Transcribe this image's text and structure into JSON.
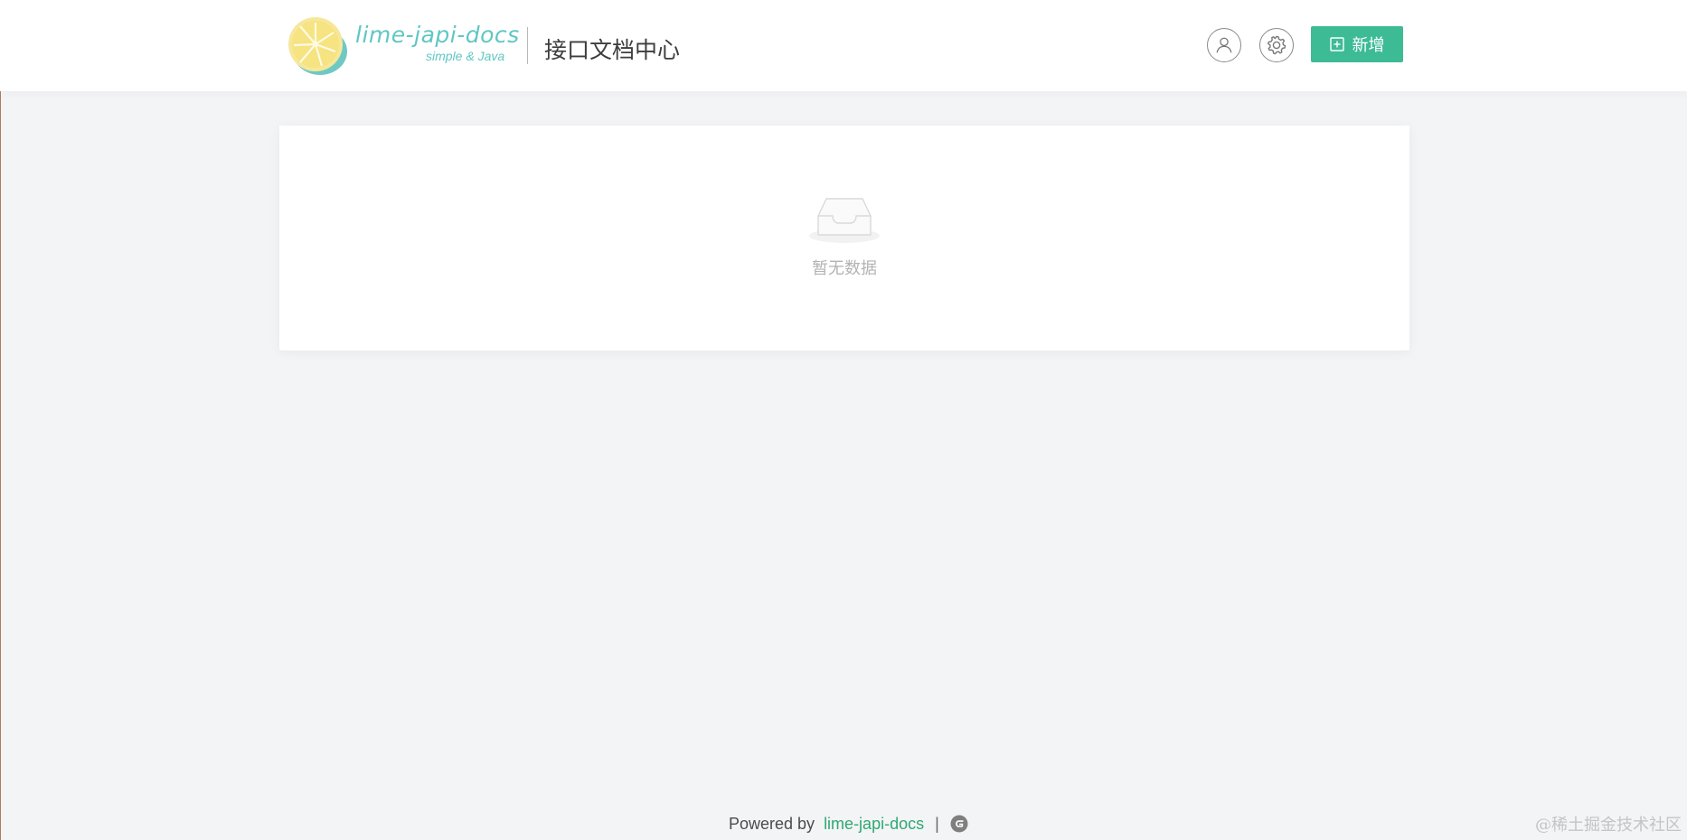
{
  "header": {
    "brand_name": "lime-japi-docs",
    "brand_tagline": "simple & Java",
    "page_title": "接口文档中心",
    "add_button_label": "新增"
  },
  "icons": {
    "logo": "lime-logo-icon",
    "user": "user-icon",
    "settings": "gear-icon",
    "add": "plus-square-icon",
    "empty": "empty-inbox-icon",
    "footer": "gitee-icon"
  },
  "main": {
    "empty_text": "暂无数据"
  },
  "footer": {
    "powered_by": "Powered by",
    "link_text": "lime-japi-docs",
    "separator": "|"
  },
  "watermark": "@稀土掘金技术社区",
  "colors": {
    "accent": "#3dbb95",
    "brand_text": "#5fc7c3",
    "background": "#f3f4f6",
    "footer_link": "#2fa872"
  }
}
